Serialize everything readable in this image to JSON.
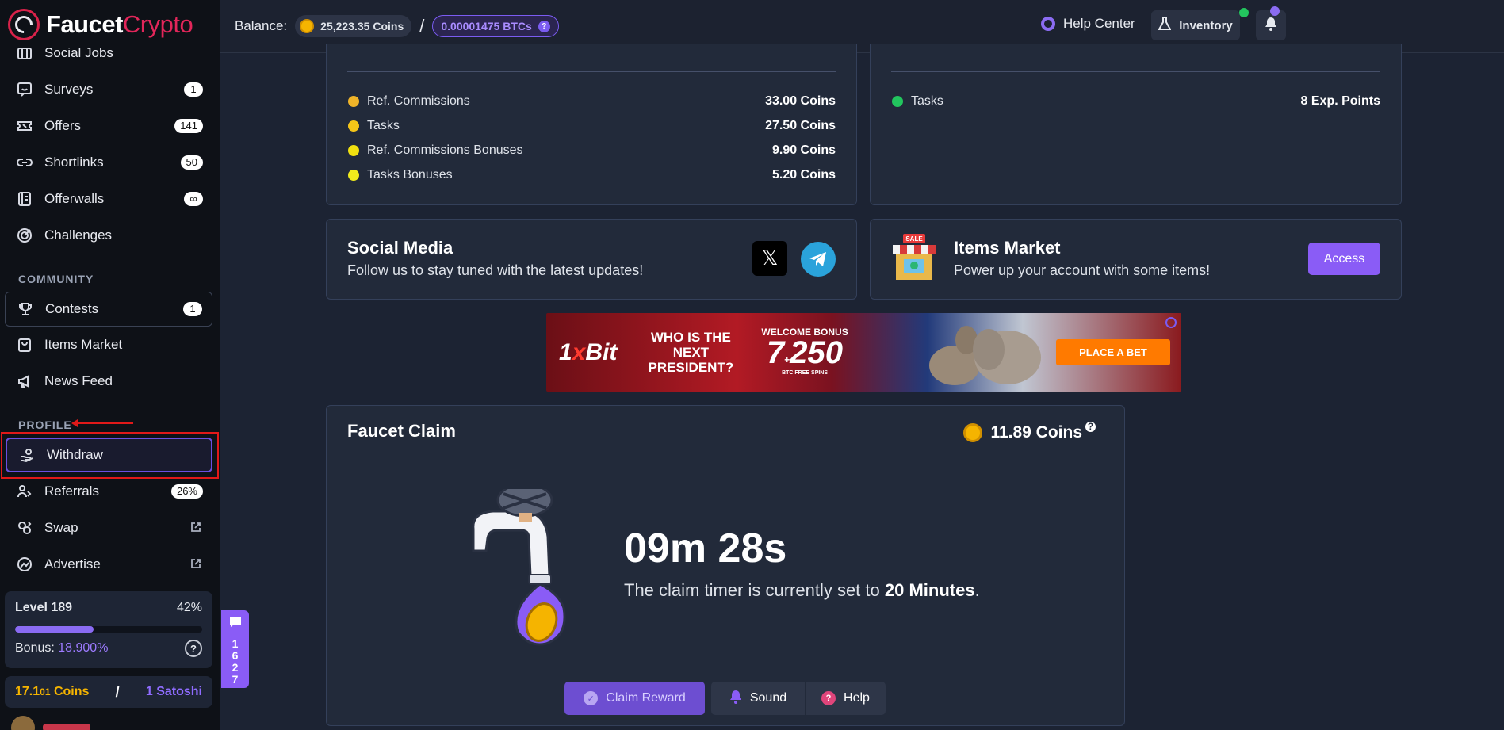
{
  "brand": {
    "part1": "Faucet",
    "part2": "Crypto"
  },
  "sidebar": {
    "top_items": [
      {
        "label": "Social Jobs",
        "badge": ""
      },
      {
        "label": "Surveys",
        "badge": "1"
      },
      {
        "label": "Offers",
        "badge": "141"
      },
      {
        "label": "Shortlinks",
        "badge": "50"
      },
      {
        "label": "Offerwalls",
        "badge": "∞"
      },
      {
        "label": "Challenges",
        "badge": ""
      }
    ],
    "community_label": "COMMUNITY",
    "community_items": [
      {
        "label": "Contests",
        "badge": "1"
      },
      {
        "label": "Items Market",
        "badge": ""
      },
      {
        "label": "News Feed",
        "badge": ""
      }
    ],
    "profile_label": "PROFILE",
    "profile_items": [
      {
        "label": "Withdraw",
        "badge": ""
      },
      {
        "label": "Referrals",
        "badge": "26%"
      },
      {
        "label": "Swap",
        "badge": ""
      },
      {
        "label": "Advertise",
        "badge": ""
      }
    ],
    "level": {
      "label": "Level 189",
      "percent": "42%",
      "progress_fraction": 0.42,
      "bonus_label": "Bonus:",
      "bonus_value": "18.900%"
    },
    "earnings": {
      "coins_main": "17.1",
      "coins_small": "01",
      "coins_unit": " Coins",
      "separator": "/",
      "satoshi": "1 Satoshi"
    }
  },
  "topbar": {
    "balance_label": "Balance:",
    "coins": "25,223.35 Coins",
    "separator": "/",
    "btc": "0.00001475 BTCs",
    "btc_help": "?",
    "help_center": "Help Center",
    "inventory": "Inventory"
  },
  "stats_left": [
    {
      "label": "Ref. Commissions",
      "value": "33.00 Coins",
      "color": "#f0b429"
    },
    {
      "label": "Tasks",
      "value": "27.50 Coins",
      "color": "#f5c518"
    },
    {
      "label": "Ref. Commissions Bonuses",
      "value": "9.90 Coins",
      "color": "#f0e010"
    },
    {
      "label": "Tasks Bonuses",
      "value": "5.20 Coins",
      "color": "#f0ea1c"
    }
  ],
  "stats_right": [
    {
      "label": "Tasks",
      "value": "8 Exp. Points",
      "color": "#22c55e"
    }
  ],
  "social": {
    "title": "Social Media",
    "subtitle": "Follow us to stay tuned with the latest updates!",
    "x_glyph": "𝕏"
  },
  "market": {
    "title": "Items Market",
    "subtitle": "Power up your account with some items!",
    "access": "Access",
    "sale_tag": "SALE"
  },
  "banner": {
    "brand_a": "1",
    "brand_x": "x",
    "brand_b": "Bit",
    "question": "WHO IS THE NEXT PRESIDENT?",
    "bonus_label": "WELCOME BONUS",
    "bonus_num": "7",
    "bonus_plus": "+",
    "bonus_num2": "250",
    "btc_small": "BTC",
    "spins": "FREE SPINS",
    "cta": "PLACE A BET"
  },
  "claim": {
    "title": "Faucet Claim",
    "coins": "11.89 Coins",
    "coins_help": "?",
    "timer": "09m 28s",
    "desc_prefix": "The claim timer is currently set to ",
    "desc_bold": "20 Minutes",
    "desc_suffix": ".",
    "claim_btn": "Claim Reward",
    "sound_btn": "Sound",
    "help_btn": "Help"
  },
  "chat": {
    "digits": [
      "1",
      "6",
      "2",
      "7"
    ]
  },
  "colors": {
    "accent": "#8a5cf6",
    "coin": "#f5b400",
    "bg": "#1c2333",
    "highlight": "#e01919"
  }
}
